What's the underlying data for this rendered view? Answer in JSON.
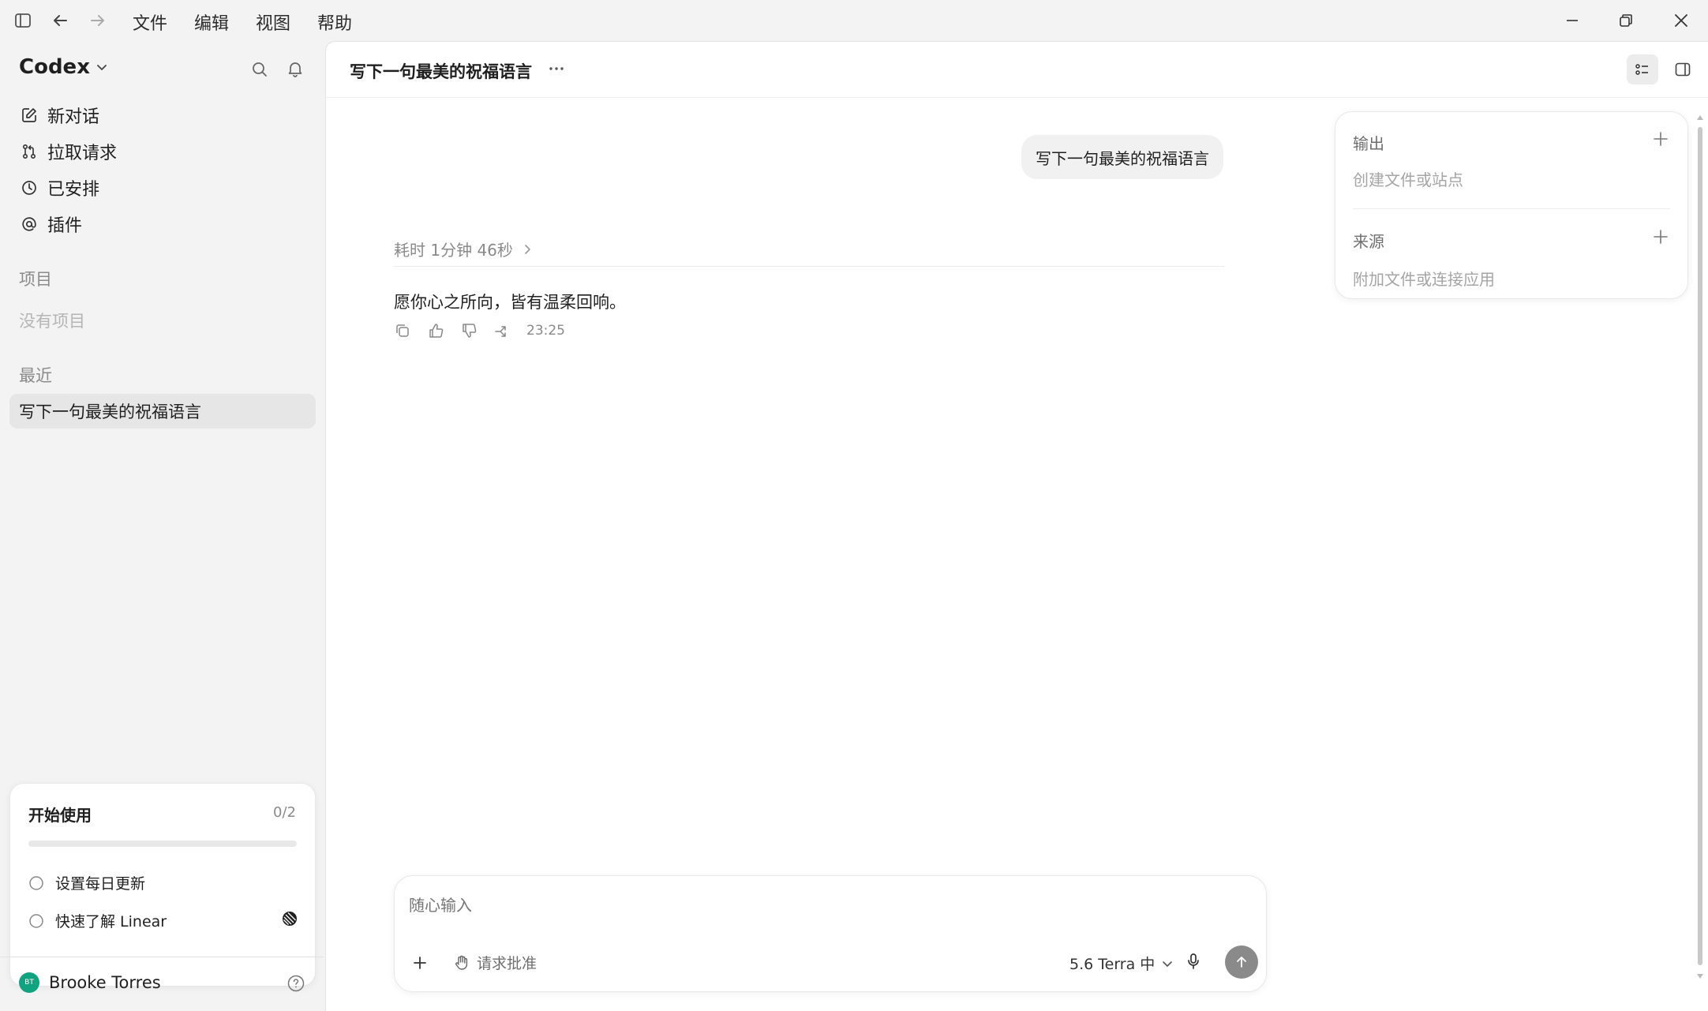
{
  "menu": [
    "文件",
    "编辑",
    "视图",
    "帮助"
  ],
  "sidebar": {
    "app_name": "Codex",
    "nav": [
      {
        "label": "新对话",
        "icon": "edit-icon"
      },
      {
        "label": "拉取请求",
        "icon": "pull-request-icon"
      },
      {
        "label": "已安排",
        "icon": "clock-icon"
      },
      {
        "label": "插件",
        "icon": "at-sign-icon"
      }
    ],
    "projects_label": "项目",
    "no_projects": "没有项目",
    "recent_label": "最近",
    "recent_items": [
      "写下一句最美的祝福语言"
    ]
  },
  "getting_started": {
    "title": "开始使用",
    "progress_text": "0/2",
    "progress": 0,
    "tasks": [
      "设置每日更新",
      "快速了解 Linear"
    ]
  },
  "user": {
    "name": "Brooke Torres",
    "initials": "BT",
    "avatar_color": "#10a37f"
  },
  "conversation": {
    "title": "写下一句最美的祝福语言",
    "user_message": "写下一句最美的祝福语言",
    "elapsed": "耗时 1分钟 46秒",
    "reply": "愿你心之所向，皆有温柔回响。",
    "time": "23:25"
  },
  "side_panel": {
    "output_title": "输出",
    "output_hint": "创建文件或站点",
    "source_title": "来源",
    "source_hint": "附加文件或连接应用"
  },
  "composer": {
    "placeholder": "随心输入",
    "approval_label": "请求批准",
    "model_label": "5.6 Terra 中"
  }
}
